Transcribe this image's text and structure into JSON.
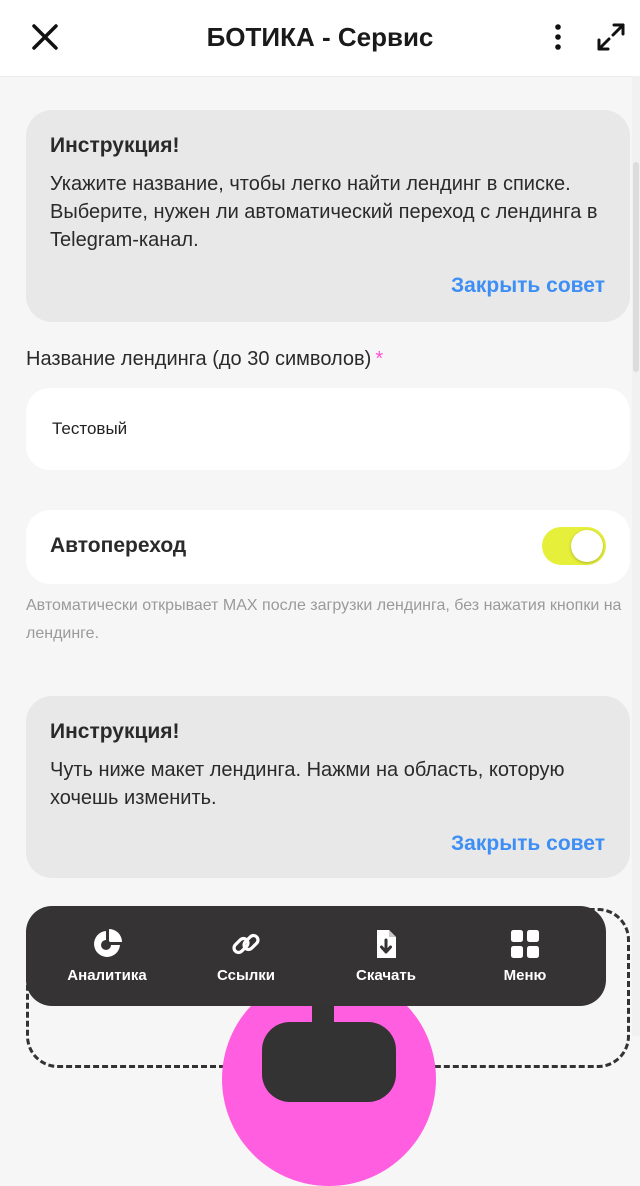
{
  "header": {
    "title": "БОТИКА - Сервис",
    "close_icon": "close-icon",
    "more_icon": "more-vertical-icon",
    "expand_icon": "expand-icon"
  },
  "tips": [
    {
      "title": "Инструкция!",
      "text": "Укажите название, чтобы легко найти лендинг в списке. Выберите, нужен ли автоматический переход с лендинга в Telegram-канал.",
      "close_label": "Закрыть совет"
    },
    {
      "title": "Инструкция!",
      "text": "Чуть ниже макет лендинга. Нажми на область, которую хочешь изменить.",
      "close_label": "Закрыть совет"
    }
  ],
  "form": {
    "name_label": "Название лендинга (до 30 символов)",
    "required_mark": "*",
    "name_value": "Тестовый",
    "autoswitch_label": "Автопереход",
    "autoswitch_on": true,
    "autoswitch_hint": "Автоматически открывает MAX после загрузки лендинга, без нажатия кнопки на лендинге."
  },
  "bottom_nav": {
    "items": [
      {
        "label": "Аналитика",
        "icon": "pie-chart-icon"
      },
      {
        "label": "Ссылки",
        "icon": "link-icon"
      },
      {
        "label": "Скачать",
        "icon": "download-file-icon"
      },
      {
        "label": "Меню",
        "icon": "grid-menu-icon"
      }
    ]
  },
  "colors": {
    "accent_link": "#3d8ef5",
    "toggle_on": "#e6f03b",
    "required": "#ff4fd8",
    "nav_bg": "#363335",
    "preview_circle": "#ff5ee0"
  }
}
